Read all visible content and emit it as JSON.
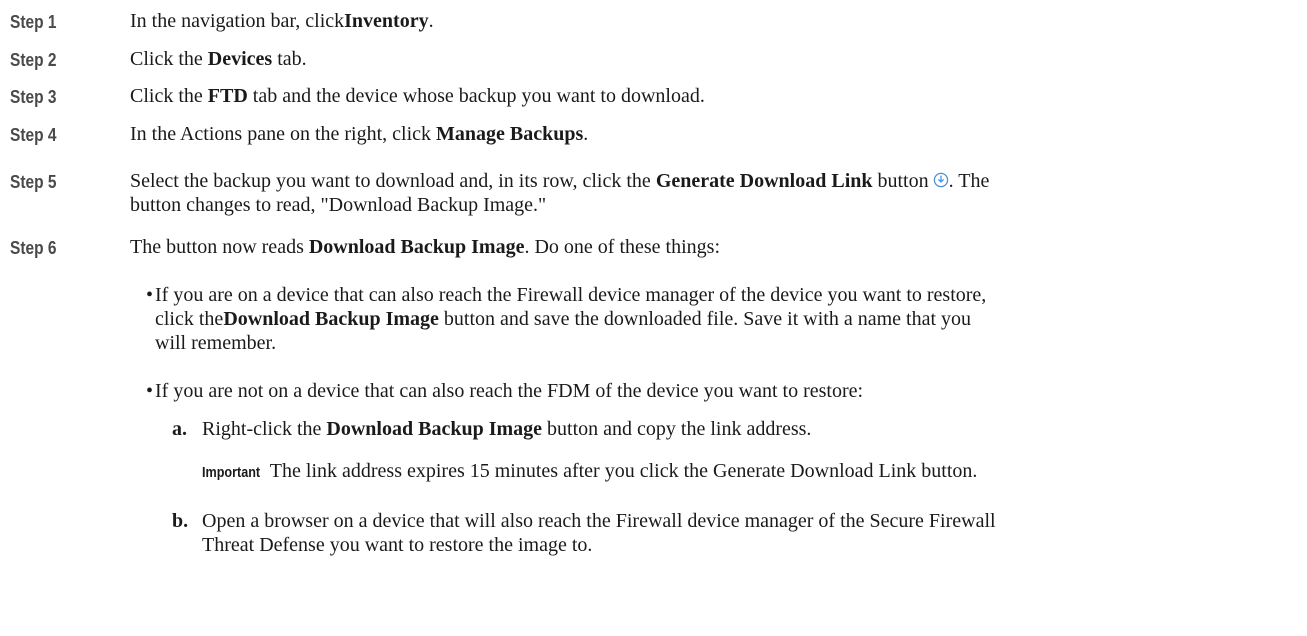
{
  "steps": [
    {
      "label": "Step 1",
      "pre": "In the navigation bar, click",
      "bold": "Inventory",
      "post": "."
    },
    {
      "label": "Step 2",
      "pre": "Click the ",
      "bold": "Devices",
      "post": " tab."
    },
    {
      "label": "Step 3",
      "pre": "Click the ",
      "bold": "FTD",
      "post": " tab and the device whose backup you want to download."
    },
    {
      "label": "Step 4",
      "pre": "In the Actions pane on the right, click ",
      "bold": "Manage Backups",
      "post": "."
    },
    {
      "label": "Step 5",
      "line1_pre": "Select the backup you want to download and, in its row, click the ",
      "line1_bold": "Generate Download Link",
      "line1_post": " button",
      "line1_end": ". The",
      "line2": "button changes to read, \"Download Backup Image.\""
    },
    {
      "label": "Step 6",
      "pre": "The button now reads ",
      "bold": "Download Backup Image",
      "post": ". Do one of these things:"
    }
  ],
  "bullets": [
    {
      "line1": "If you are on a device that can also reach the Firewall device manager of the device you want to restore,",
      "line2_pre": "click the",
      "line2_bold": "Download Backup Image",
      "line2_post": " button and save the downloaded file. Save it with a name that you",
      "line3": "will remember."
    },
    {
      "line1": "If you are not on a device that can also reach the FDM of the device you want to restore:"
    }
  ],
  "substeps": [
    {
      "label": "a.",
      "pre": "Right-click the ",
      "bold": "Download Backup Image",
      "post": " button and copy the link address."
    },
    {
      "label": "b.",
      "line1": "Open a browser on a device that will also reach the Firewall device manager of the Secure Firewall",
      "line2": "Threat Defense you want to restore the image to."
    }
  ],
  "important": {
    "label": "Important",
    "text": " The link address expires 15 minutes after you click the Generate Download Link button."
  },
  "bullet_glyph": "•",
  "icons": {
    "generate_link": "download-link-icon",
    "color": "#4a90e2"
  }
}
